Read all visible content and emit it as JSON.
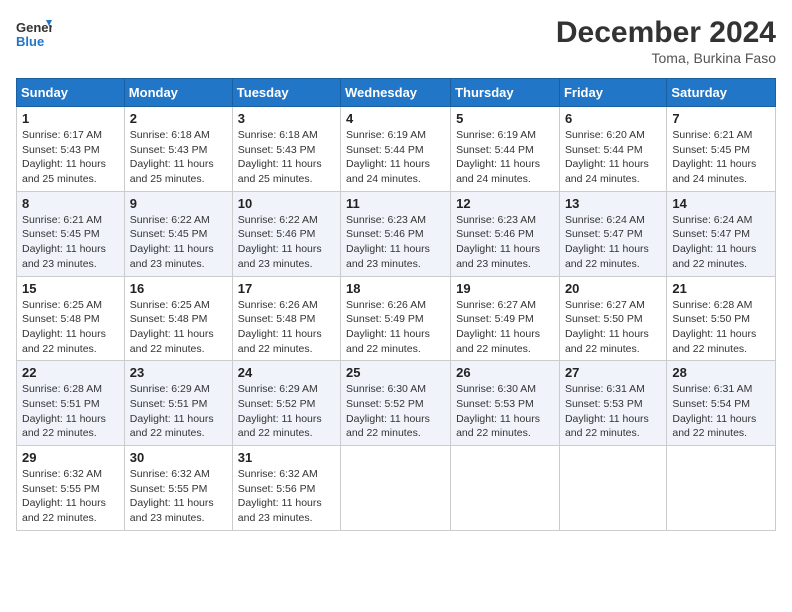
{
  "header": {
    "logo_line1": "General",
    "logo_line2": "Blue",
    "month_year": "December 2024",
    "location": "Toma, Burkina Faso"
  },
  "weekdays": [
    "Sunday",
    "Monday",
    "Tuesday",
    "Wednesday",
    "Thursday",
    "Friday",
    "Saturday"
  ],
  "weeks": [
    [
      {
        "day": "1",
        "info": "Sunrise: 6:17 AM\nSunset: 5:43 PM\nDaylight: 11 hours and 25 minutes."
      },
      {
        "day": "2",
        "info": "Sunrise: 6:18 AM\nSunset: 5:43 PM\nDaylight: 11 hours and 25 minutes."
      },
      {
        "day": "3",
        "info": "Sunrise: 6:18 AM\nSunset: 5:43 PM\nDaylight: 11 hours and 25 minutes."
      },
      {
        "day": "4",
        "info": "Sunrise: 6:19 AM\nSunset: 5:44 PM\nDaylight: 11 hours and 24 minutes."
      },
      {
        "day": "5",
        "info": "Sunrise: 6:19 AM\nSunset: 5:44 PM\nDaylight: 11 hours and 24 minutes."
      },
      {
        "day": "6",
        "info": "Sunrise: 6:20 AM\nSunset: 5:44 PM\nDaylight: 11 hours and 24 minutes."
      },
      {
        "day": "7",
        "info": "Sunrise: 6:21 AM\nSunset: 5:45 PM\nDaylight: 11 hours and 24 minutes."
      }
    ],
    [
      {
        "day": "8",
        "info": "Sunrise: 6:21 AM\nSunset: 5:45 PM\nDaylight: 11 hours and 23 minutes."
      },
      {
        "day": "9",
        "info": "Sunrise: 6:22 AM\nSunset: 5:45 PM\nDaylight: 11 hours and 23 minutes."
      },
      {
        "day": "10",
        "info": "Sunrise: 6:22 AM\nSunset: 5:46 PM\nDaylight: 11 hours and 23 minutes."
      },
      {
        "day": "11",
        "info": "Sunrise: 6:23 AM\nSunset: 5:46 PM\nDaylight: 11 hours and 23 minutes."
      },
      {
        "day": "12",
        "info": "Sunrise: 6:23 AM\nSunset: 5:46 PM\nDaylight: 11 hours and 23 minutes."
      },
      {
        "day": "13",
        "info": "Sunrise: 6:24 AM\nSunset: 5:47 PM\nDaylight: 11 hours and 22 minutes."
      },
      {
        "day": "14",
        "info": "Sunrise: 6:24 AM\nSunset: 5:47 PM\nDaylight: 11 hours and 22 minutes."
      }
    ],
    [
      {
        "day": "15",
        "info": "Sunrise: 6:25 AM\nSunset: 5:48 PM\nDaylight: 11 hours and 22 minutes."
      },
      {
        "day": "16",
        "info": "Sunrise: 6:25 AM\nSunset: 5:48 PM\nDaylight: 11 hours and 22 minutes."
      },
      {
        "day": "17",
        "info": "Sunrise: 6:26 AM\nSunset: 5:48 PM\nDaylight: 11 hours and 22 minutes."
      },
      {
        "day": "18",
        "info": "Sunrise: 6:26 AM\nSunset: 5:49 PM\nDaylight: 11 hours and 22 minutes."
      },
      {
        "day": "19",
        "info": "Sunrise: 6:27 AM\nSunset: 5:49 PM\nDaylight: 11 hours and 22 minutes."
      },
      {
        "day": "20",
        "info": "Sunrise: 6:27 AM\nSunset: 5:50 PM\nDaylight: 11 hours and 22 minutes."
      },
      {
        "day": "21",
        "info": "Sunrise: 6:28 AM\nSunset: 5:50 PM\nDaylight: 11 hours and 22 minutes."
      }
    ],
    [
      {
        "day": "22",
        "info": "Sunrise: 6:28 AM\nSunset: 5:51 PM\nDaylight: 11 hours and 22 minutes."
      },
      {
        "day": "23",
        "info": "Sunrise: 6:29 AM\nSunset: 5:51 PM\nDaylight: 11 hours and 22 minutes."
      },
      {
        "day": "24",
        "info": "Sunrise: 6:29 AM\nSunset: 5:52 PM\nDaylight: 11 hours and 22 minutes."
      },
      {
        "day": "25",
        "info": "Sunrise: 6:30 AM\nSunset: 5:52 PM\nDaylight: 11 hours and 22 minutes."
      },
      {
        "day": "26",
        "info": "Sunrise: 6:30 AM\nSunset: 5:53 PM\nDaylight: 11 hours and 22 minutes."
      },
      {
        "day": "27",
        "info": "Sunrise: 6:31 AM\nSunset: 5:53 PM\nDaylight: 11 hours and 22 minutes."
      },
      {
        "day": "28",
        "info": "Sunrise: 6:31 AM\nSunset: 5:54 PM\nDaylight: 11 hours and 22 minutes."
      }
    ],
    [
      {
        "day": "29",
        "info": "Sunrise: 6:32 AM\nSunset: 5:55 PM\nDaylight: 11 hours and 22 minutes."
      },
      {
        "day": "30",
        "info": "Sunrise: 6:32 AM\nSunset: 5:55 PM\nDaylight: 11 hours and 23 minutes."
      },
      {
        "day": "31",
        "info": "Sunrise: 6:32 AM\nSunset: 5:56 PM\nDaylight: 11 hours and 23 minutes."
      },
      null,
      null,
      null,
      null
    ]
  ]
}
